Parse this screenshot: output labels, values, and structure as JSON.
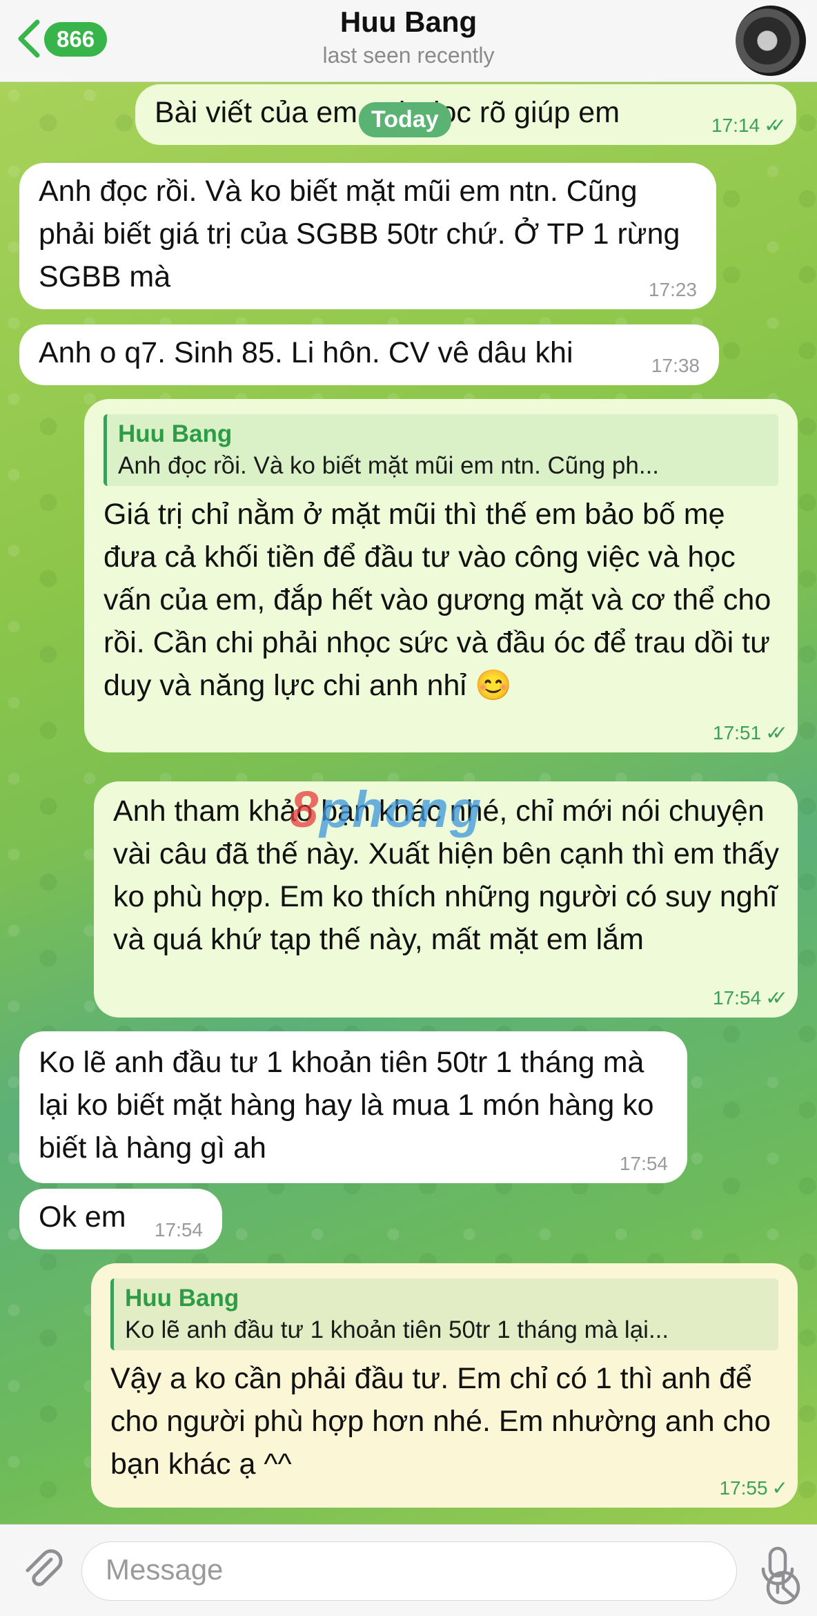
{
  "header": {
    "back_count": "866",
    "title": "Huu Bang",
    "status": "last seen recently"
  },
  "date_badge": "Today",
  "watermark": {
    "part1": "8",
    "part2": "phong"
  },
  "messages": [
    {
      "dir": "out",
      "text": "Bài viết của em anh đọc rõ giúp em",
      "time": "17:14",
      "status": "read"
    },
    {
      "dir": "in",
      "text": "Anh đọc rồi. Và ko biết mặt mũi em ntn. Cũng phải biết giá trị của SGBB 50tr chứ. Ở TP 1 rừng SGBB mà",
      "time": "17:23"
    },
    {
      "dir": "in",
      "text": "Anh o q7. Sinh 85. Li hôn. CV vê dâu khi",
      "time": "17:38"
    },
    {
      "dir": "out",
      "reply_name": "Huu Bang",
      "reply_text": "Anh đọc rồi. Và ko biết mặt mũi em ntn. Cũng ph...",
      "text": "Giá trị chỉ nằm ở mặt mũi thì thế em bảo bố mẹ đưa cả khối tiền để đầu tư vào công việc và học vấn của em, đắp hết vào gương mặt và cơ thể cho rồi. Cần chi phải nhọc sức và đầu óc để trau dồi tư duy và năng lực chi anh nhỉ 😊",
      "time": "17:51",
      "status": "read"
    },
    {
      "dir": "out",
      "text": "Anh tham khảo bạn khác nhé, chỉ mới nói chuyện vài câu đã thế này. Xuất hiện bên cạnh thì em thấy ko phù hợp. Em ko thích những người có suy nghĩ và quá khứ tạp thế này, mất mặt em lắm",
      "time": "17:54",
      "status": "read"
    },
    {
      "dir": "in",
      "text": "Ko lẽ anh đầu tư 1 khoản tiên 50tr 1 tháng mà lại ko biết mặt hàng hay là mua 1 món hàng ko biết là hàng gì ah",
      "time": "17:54"
    },
    {
      "dir": "in",
      "text": "Ok em",
      "time": "17:54"
    },
    {
      "dir": "out",
      "reply_name": "Huu Bang",
      "reply_text": "Ko lẽ anh đầu tư 1 khoản tiên 50tr 1 tháng mà lại...",
      "text": "Vậy a ko cần phải đầu tư. Em chỉ có 1 thì anh để cho người phù hợp hơn nhé. Em nhường anh cho bạn khác ạ ^^",
      "time": "17:55",
      "status": "sent"
    }
  ],
  "input": {
    "placeholder": "Message"
  },
  "colors": {
    "accent": "#37b54a",
    "outgoing_bubble": "#effbd8",
    "incoming_bubble": "#ffffff"
  }
}
